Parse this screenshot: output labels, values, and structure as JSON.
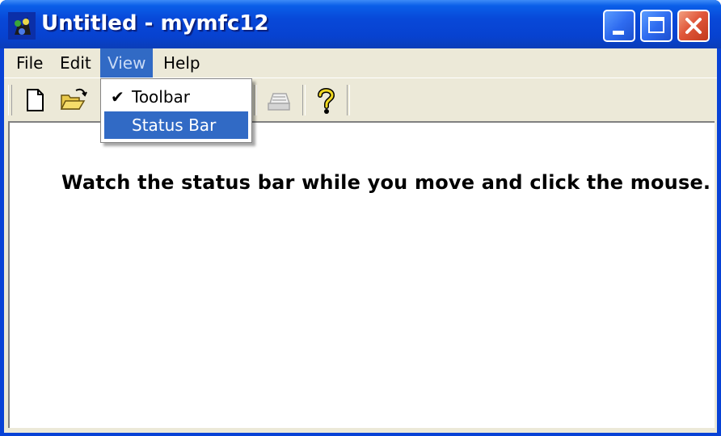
{
  "window": {
    "title": "Untitled - mymfc12",
    "controls": {
      "minimize": "minimize-icon",
      "maximize": "maximize-icon",
      "close": "close-icon"
    }
  },
  "menubar": {
    "items": [
      {
        "label": "File"
      },
      {
        "label": "Edit"
      },
      {
        "label": "View",
        "active": true
      },
      {
        "label": "Help"
      }
    ]
  },
  "view_menu": {
    "items": [
      {
        "label": "Toolbar",
        "checked": true
      },
      {
        "label": "Status Bar",
        "highlighted": true
      }
    ]
  },
  "toolbar": {
    "buttons": [
      {
        "icon": "new-document-icon"
      },
      {
        "icon": "open-folder-icon"
      },
      {
        "icon": "print-icon",
        "disabled": true
      },
      {
        "icon": "help-icon"
      }
    ]
  },
  "content": {
    "message": "Watch the status bar while you move and click the mouse."
  },
  "colors": {
    "titlebar": "#0842d6",
    "menu_highlight": "#316ac5",
    "face": "#ece9d8",
    "close_button": "#e0573a"
  }
}
